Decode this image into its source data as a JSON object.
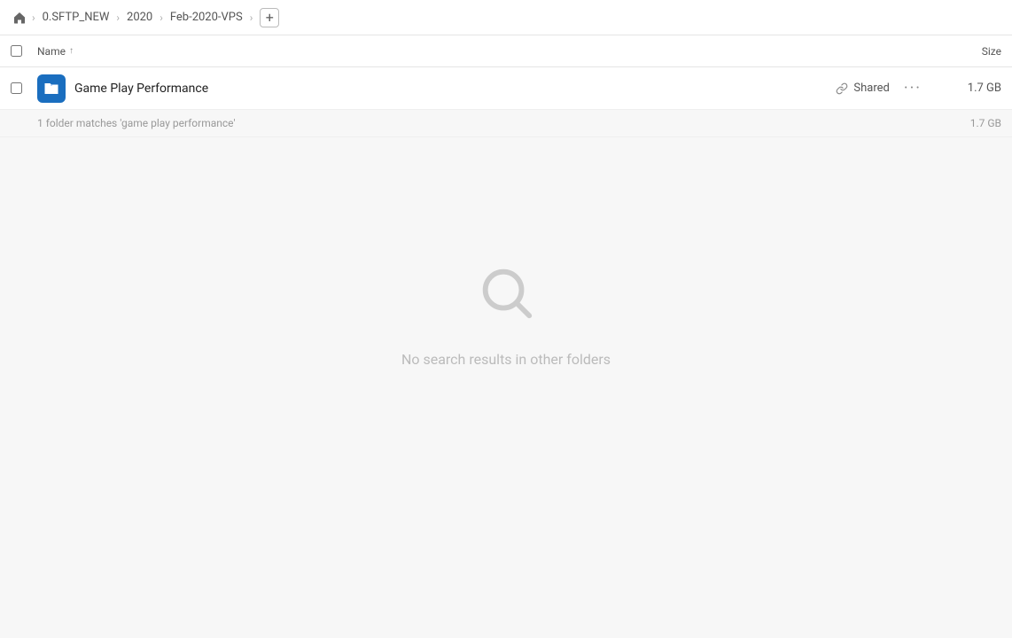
{
  "breadcrumb": {
    "home_icon": "🏠",
    "items": [
      {
        "label": "0.SFTP_NEW"
      },
      {
        "label": "2020"
      },
      {
        "label": "Feb-2020-VPS"
      }
    ],
    "add_button": "+"
  },
  "table": {
    "col_name": "Name",
    "col_size": "Size",
    "sort_indicator": "↑"
  },
  "file_row": {
    "name": "Game Play Performance",
    "shared_label": "Shared",
    "size": "1.7 GB",
    "actions": "···"
  },
  "match_info": {
    "text": "1 folder matches 'game play performance'",
    "size": "1.7 GB"
  },
  "empty_state": {
    "title": "No search results in other folders"
  }
}
